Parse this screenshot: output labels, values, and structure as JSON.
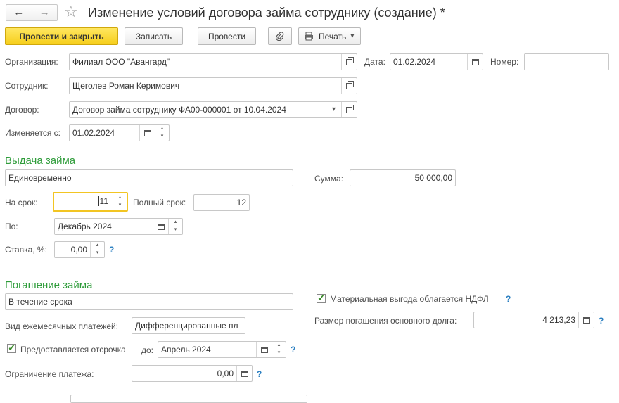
{
  "window": {
    "title": "Изменение условий договора займа сотруднику (создание) *"
  },
  "toolbar": {
    "post_close": "Провести и закрыть",
    "save": "Записать",
    "post": "Провести",
    "print": "Печать"
  },
  "header": {
    "org_label": "Организация:",
    "org_value": "Филиал ООО \"Авангард\"",
    "date_label": "Дата:",
    "date_value": "01.02.2024",
    "number_label": "Номер:",
    "number_value": "",
    "employee_label": "Сотрудник:",
    "employee_value": "Щеголев Роман Керимович",
    "contract_label": "Договор:",
    "contract_value": "Договор займа сотруднику ФА00-000001 от 10.04.2024",
    "changed_from_label": "Изменяется с:",
    "changed_from_value": "01.02.2024"
  },
  "issue": {
    "title": "Выдача займа",
    "method": "Единовременно",
    "sum_label": "Сумма:",
    "sum_value": "50 000,00",
    "term_label": "На срок:",
    "term_value": "11",
    "full_term_label": "Полный срок:",
    "full_term_value": "12",
    "until_label": "По:",
    "until_value": "Декабрь 2024",
    "rate_label": "Ставка, %:",
    "rate_value": "0,00",
    "help": "?"
  },
  "repay": {
    "title": "Погашение займа",
    "method": "В течение срока",
    "ndfl_label": "Материальная выгода облагается НДФЛ",
    "ndfl_checked": true,
    "payment_type_label": "Вид ежемесячных платежей:",
    "payment_type_value": "Дифференцированные пл",
    "principal_label": "Размер погашения основного долга:",
    "principal_value": "4 213,23",
    "deferral_label": "Предоставляется отсрочка",
    "deferral_checked": true,
    "deferral_to_label": "до:",
    "deferral_to_value": "Апрель 2024",
    "limit_label": "Ограничение платежа:",
    "limit_value": "0,00",
    "help": "?"
  },
  "icons": {
    "back": "←",
    "forward": "→",
    "star": "☆",
    "check": "✓",
    "dropdown": "▾",
    "spin_up": "▴",
    "spin_down": "▾"
  }
}
